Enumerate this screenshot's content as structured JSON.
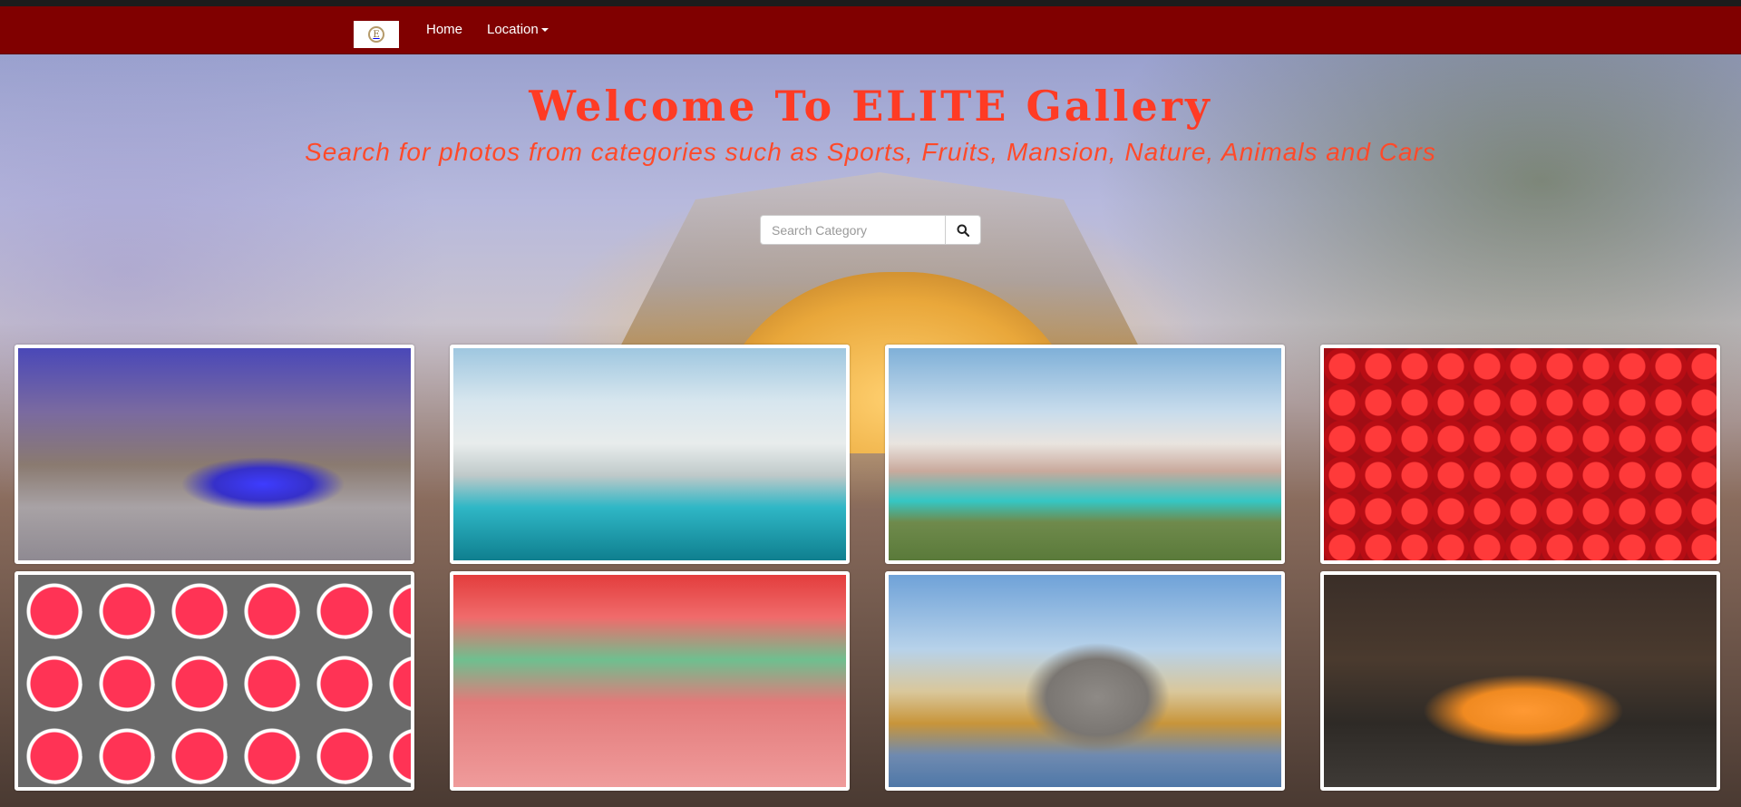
{
  "navbar": {
    "logo_alt": "ELITE Gallery logo",
    "logo_glyph": "E",
    "home_label": "Home",
    "location_label": "Location",
    "background_color": "#800000"
  },
  "hero": {
    "title": "Welcome To ELITE Gallery",
    "subtitle": "Search for photos from categories such as Sports, Fruits, Mansion, Nature, Animals and Cars",
    "title_color": "#ff3b24"
  },
  "search": {
    "placeholder": "Search Category",
    "value": "",
    "button_icon": "search-icon"
  },
  "gallery": {
    "items": [
      {
        "subject": "mansion with pool at dusk"
      },
      {
        "subject": "modern glass house with pool"
      },
      {
        "subject": "white modern villa with pool"
      },
      {
        "subject": "strawberries"
      },
      {
        "subject": "sliced citrus fruits"
      },
      {
        "subject": "sprinters on running track"
      },
      {
        "subject": "elephant at watering hole"
      },
      {
        "subject": "orange sports car"
      }
    ]
  }
}
